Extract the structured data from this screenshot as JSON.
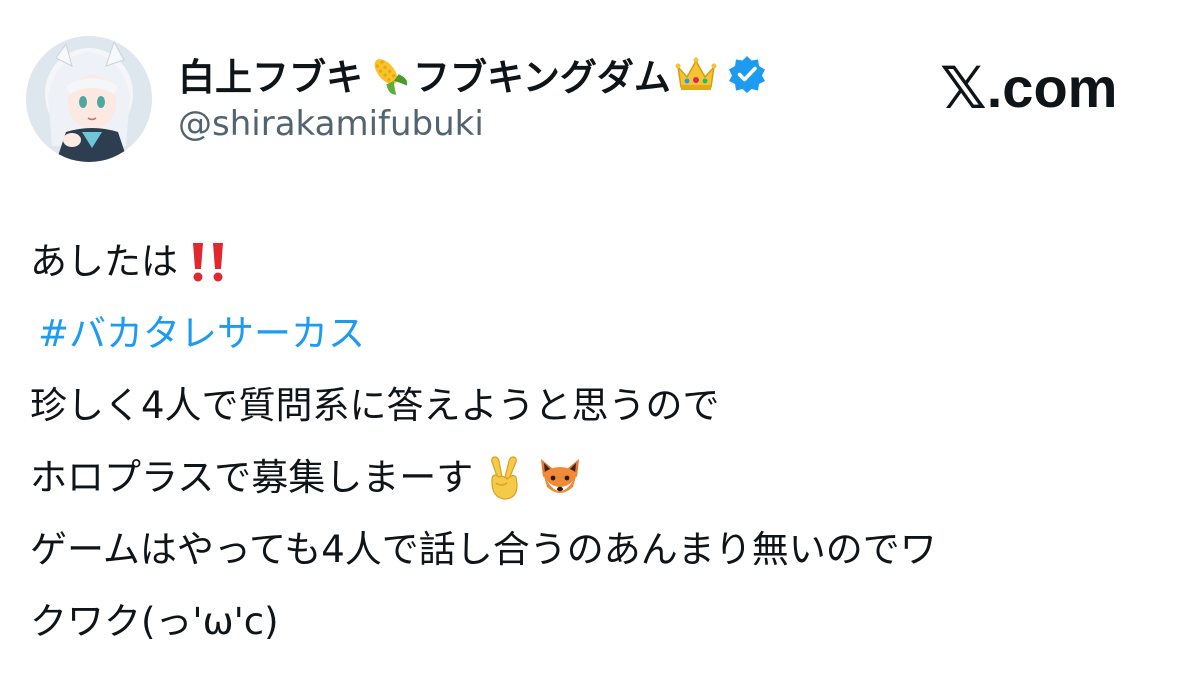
{
  "author": {
    "display_name_part1": "白上フブキ",
    "display_name_part2": "フブキングダム",
    "handle": "@shirakamifubuki",
    "name_emoji_1": "corn-emoji",
    "name_emoji_2": "crown-emoji",
    "verified_icon": "verified-badge-icon",
    "verified_color": "#1d9bf0"
  },
  "brand": {
    "x_glyph": "𝕏",
    "suffix": ".com"
  },
  "tweet": {
    "line1_text": "あしたは",
    "line1_emoji": "double-exclamation-emoji",
    "hashtag": "#バカタレサーカス",
    "line3": "珍しく4人で質問系に答えようと思うので",
    "line4_text": "ホロプラスで募集しまーす",
    "line4_emoji_1": "victory-hand-emoji",
    "line4_emoji_2": "fox-emoji",
    "line5": "ゲームはやっても4人で話し合うのあんまり無いのでワ",
    "line6": "クワク(っ'ω'c)"
  },
  "colors": {
    "text": "#0f1419",
    "muted": "#536471",
    "link": "#1d9bf0",
    "background": "#ffffff"
  }
}
